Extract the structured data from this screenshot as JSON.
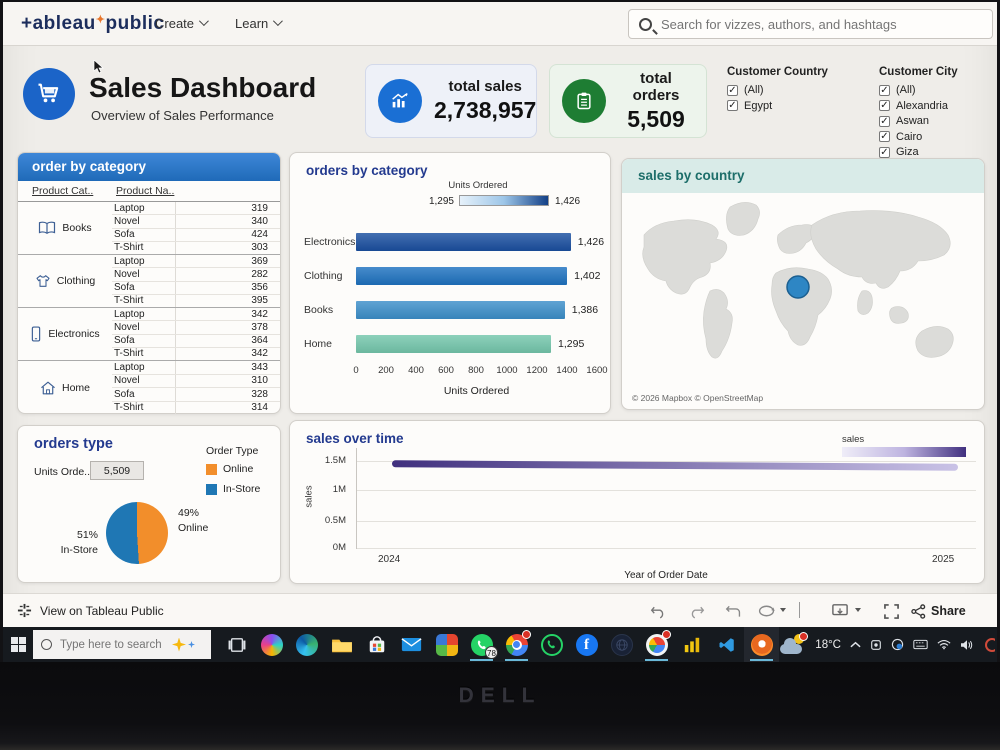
{
  "nav": {
    "brand_text": "+ableau",
    "brand_suffix": "public",
    "menus": [
      {
        "label": "Create"
      },
      {
        "label": "Learn"
      }
    ],
    "search_placeholder": "Search for vizzes, authors, and hashtags"
  },
  "header": {
    "title": "Sales Dashboard",
    "subtitle": "Overview of Sales Performance"
  },
  "kpis": [
    {
      "label": "total sales",
      "value": "2,738,957",
      "color": "#1a6fd4"
    },
    {
      "label": "total orders",
      "value": "5,509",
      "color": "#1e7d33"
    }
  ],
  "filters": [
    {
      "title": "Customer Country",
      "options": [
        "(All)",
        "Egypt"
      ]
    },
    {
      "title": "Customer City",
      "options": [
        "(All)",
        "Alexandria",
        "Aswan",
        "Cairo",
        "Giza"
      ]
    }
  ],
  "category_table": {
    "title": "order by category",
    "col1": "Product Cat..",
    "col2": "Product Na..",
    "groups": [
      {
        "category": "Books",
        "rows": [
          [
            "Laptop",
            "319"
          ],
          [
            "Novel",
            "340"
          ],
          [
            "Sofa",
            "424"
          ],
          [
            "T-Shirt",
            "303"
          ]
        ]
      },
      {
        "category": "Clothing",
        "rows": [
          [
            "Laptop",
            "369"
          ],
          [
            "Novel",
            "282"
          ],
          [
            "Sofa",
            "356"
          ],
          [
            "T-Shirt",
            "395"
          ]
        ]
      },
      {
        "category": "Electronics",
        "rows": [
          [
            "Laptop",
            "342"
          ],
          [
            "Novel",
            "378"
          ],
          [
            "Sofa",
            "364"
          ],
          [
            "T-Shirt",
            "342"
          ]
        ]
      },
      {
        "category": "Home",
        "rows": [
          [
            "Laptop",
            "343"
          ],
          [
            "Novel",
            "310"
          ],
          [
            "Sofa",
            "328"
          ],
          [
            "T-Shirt",
            "314"
          ]
        ]
      }
    ]
  },
  "bar_panel": {
    "title": "orders by category",
    "legend_title": "Units Ordered",
    "legend_min": "1,295",
    "legend_max": "1,426",
    "ticks": [
      "0",
      "200",
      "400",
      "600",
      "800",
      "1000",
      "1200",
      "1400",
      "1600"
    ],
    "axis_label": "Units Ordered"
  },
  "map_panel": {
    "title": "sales by country",
    "attribution": "© 2026 Mapbox © OpenStreetMap"
  },
  "orders_type": {
    "title": "orders type",
    "measure_label": "Units Orde..",
    "measure_value": "5,509",
    "legend_title": "Order Type",
    "legend": [
      {
        "label": "Online",
        "color": "#f28e2b"
      },
      {
        "label": "In-Store",
        "color": "#1f77b4"
      }
    ],
    "pie_labels": [
      {
        "pct": "49%",
        "name": "Online"
      },
      {
        "pct": "51%",
        "name": "In-Store"
      }
    ]
  },
  "sales_over_time": {
    "title": "sales over time",
    "legend_title": "sales",
    "y_ticks": [
      "1.5M",
      "1M",
      "0.5M",
      "0M"
    ],
    "y_label": "sales",
    "x_ticks": [
      "2024",
      "2025"
    ],
    "x_label": "Year of Order Date"
  },
  "toolbar": {
    "view_label": "View on Tableau Public",
    "share_label": "Share"
  },
  "taskbar": {
    "search_placeholder": "Type here to search",
    "whatsapp_badge": "78",
    "temperature": "18°C"
  },
  "monitor_brand": "DELL",
  "chart_data": [
    {
      "type": "bar",
      "title": "orders by category",
      "orientation": "horizontal",
      "categories": [
        "Electronics",
        "Clothing",
        "Books",
        "Home"
      ],
      "values": [
        1426,
        1402,
        1386,
        1295
      ],
      "data_labels": [
        "1,426",
        "1,402",
        "1,386",
        "1,295"
      ],
      "colors": [
        "#1a4fa0",
        "#1e72c0",
        "#3c8fca",
        "#74c7ac"
      ],
      "xlabel": "Units Ordered",
      "xlim": [
        0,
        1600
      ],
      "legend": {
        "title": "Units Ordered",
        "min": 1295,
        "max": 1426,
        "position": "top"
      }
    },
    {
      "type": "pie",
      "title": "orders type",
      "slices": [
        {
          "label": "Online",
          "pct": 49,
          "color": "#f28e2b"
        },
        {
          "label": "In-Store",
          "pct": 51,
          "color": "#1f77b4"
        }
      ]
    },
    {
      "type": "line",
      "title": "sales over time",
      "x": [
        2024,
        2025
      ],
      "series": [
        {
          "name": "sales",
          "values": [
            1450000,
            1400000
          ]
        }
      ],
      "ylim": [
        0,
        1500000
      ],
      "xlabel": "Year of Order Date",
      "ylabel": "sales",
      "line_gradient": [
        "#40307e",
        "#c9c2e6"
      ],
      "legend_position": "top-right"
    },
    {
      "type": "map",
      "title": "sales by country",
      "points": [
        {
          "label": "Egypt",
          "color": "#2e86c4"
        }
      ]
    }
  ]
}
